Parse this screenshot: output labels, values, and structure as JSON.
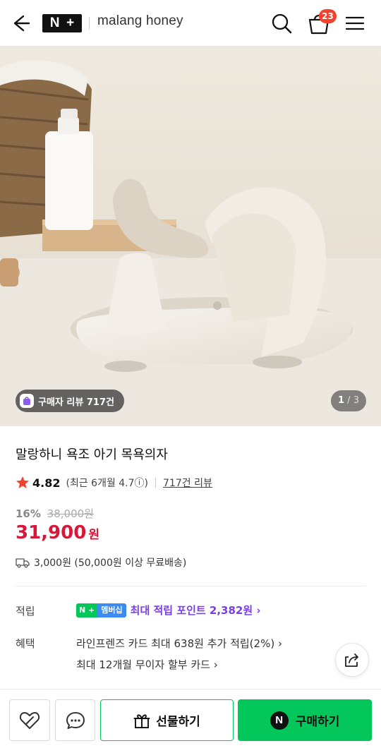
{
  "header": {
    "logo_n": "N",
    "logo_plus": "+",
    "brand": "malang honey",
    "cart_count": "23"
  },
  "gallery": {
    "review_badge": "구매자 리뷰 717건",
    "page_current": "1",
    "page_separator": " / ",
    "page_total": "3"
  },
  "product": {
    "title": "말랑하니 욕조 아기 목욕의자",
    "rating": "4.82",
    "recent_rating": "(최근 6개월 4.7ⓘ)",
    "review_link": "717건 리뷰",
    "discount_pct": "16%",
    "original_price": "38,000원",
    "price": "31,900",
    "price_unit": "원",
    "shipping": "3,000원 (50,000원 이상 무료배송)"
  },
  "benefits": {
    "points_label": "적립",
    "membership_n": "N +",
    "membership_label": "멤버십",
    "points_text": "최대 적립 포인트 2,382원 ›",
    "benefit_label": "혜택",
    "benefit_line1": "라인프렌즈 카드 최대 638원 추가 적립(2%) ›",
    "benefit_line2": "최대 12개월 무이자 할부 카드 ›"
  },
  "bottom_bar": {
    "gift_label": "선물하기",
    "buy_label": "구매하기",
    "buy_icon_letter": "N"
  },
  "colors": {
    "price_red": "#d6193a",
    "naver_green": "#03c75a",
    "points_purple": "#7a3df0",
    "badge_red": "#f0422f"
  }
}
